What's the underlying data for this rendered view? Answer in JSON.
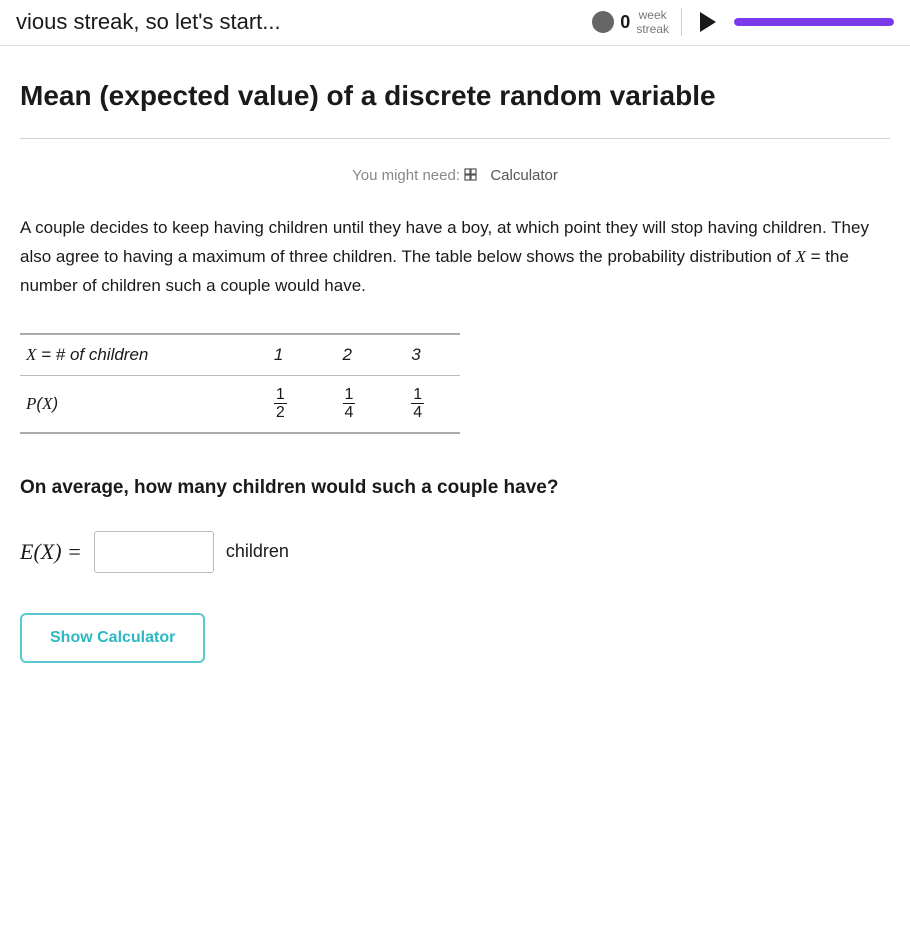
{
  "topbar": {
    "title_partial": "vious streak, so let's start...",
    "streak_label": "week\nstreak",
    "streak_count": "0"
  },
  "page": {
    "title": "Mean (expected value) of a discrete random variable",
    "you_might_need_label": "You might need:",
    "calculator_label": "Calculator",
    "problem_text": "A couple decides to keep having children until they have a boy, at which point they will stop having children. They also agree to having a maximum of three children. The table below shows the probability distribution of X = the number of children such a couple would have.",
    "table": {
      "row1_label": "X = # of children",
      "row1_values": [
        "1",
        "2",
        "3"
      ],
      "row2_label": "P(X)",
      "row2_fractions": [
        {
          "num": "1",
          "den": "2"
        },
        {
          "num": "1",
          "den": "4"
        },
        {
          "num": "1",
          "den": "4"
        }
      ]
    },
    "question": "On average, how many children would such a couple have?",
    "answer_prefix": "E(X) =",
    "answer_placeholder": "",
    "answer_unit": "children",
    "show_calculator_label": "Show Calculator"
  }
}
